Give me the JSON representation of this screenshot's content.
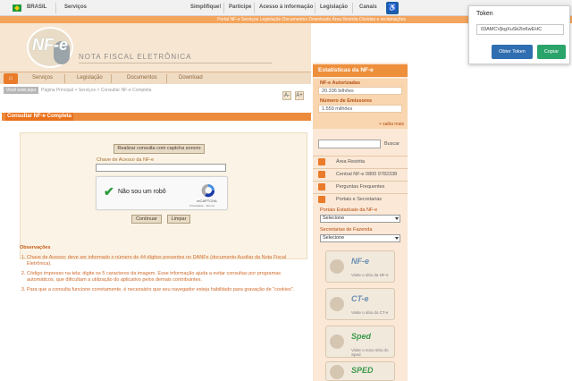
{
  "gov_bar": {
    "country": "BRASIL",
    "services": "Serviços",
    "links": [
      "Simplifique!",
      "Participe",
      "Acesso à informação",
      "Legislação",
      "Canais"
    ],
    "access_icon": "accessibility-icon"
  },
  "top_links": "Portal NF-e  Serviços  Legislação  Documentos  Downloads  Área Restrita  Dúvidas e reclamações",
  "header": {
    "logo_text": "NF-e",
    "brand": "NOTA FISCAL ELETRÔNICA"
  },
  "nav": {
    "items": [
      "Serviços",
      "Legislação",
      "Documentos",
      "Download"
    ],
    "home_icon": "home-icon"
  },
  "breadcrumb": {
    "you_are_here": "Você está aqui",
    "trail": "Página Principal > Serviços > Consultar NF-e Completa"
  },
  "page_title": "Consultar NF-e Completa",
  "form": {
    "captcha_sound_button": "Realizar consulta com captcha sonoro",
    "access_key_label": "Chave de Acesso da NF-e",
    "access_key_value": "",
    "recaptcha_text": "Não sou um robô",
    "recaptcha_brand": "reCAPTCHA",
    "recaptcha_links": "Privacidade - Termos",
    "continue_button": "Continuar",
    "clear_button": "Limpar"
  },
  "observations": {
    "title": "Observações",
    "items": [
      "Chave de Acesso: deve ser informado o número de 44 dígitos presentes no DANFe (documento Auxiliar da Nota Fiscal Eletrônica).",
      "Código impresso na tela: digite os 5 caracteres da imagem. Esse informação ajuda a evitar consultas por programas automáticos, que dificultam a utilização do aplicativo pelos demais contribuintes.",
      "Para que a consulta funcione corretamente, é necessário que seu navegador esteja habilitado para gravação de \"cookies\"."
    ]
  },
  "sidebar": {
    "stats_title": "Estatísticas da NF-e",
    "authorized_label": "NF-e Autorizadas",
    "authorized_value": "20.336 bilhões",
    "issuers_label": "Número de Emissores",
    "issuers_value": "1.559 milhões",
    "more_link": "+ saiba mais",
    "search_button": "Buscar",
    "links": [
      "Área Restrita",
      "Central NF-e 0800 9782338",
      "Perguntas Frequentes",
      "Portais e Secretarias"
    ],
    "state_portals_label": "Portais Estaduais da NF-e",
    "state_portals_value": "Selecione",
    "finance_label": "Secretarias de Fazenda",
    "finance_value": "Selecione",
    "promos": [
      {
        "main": "NF-e",
        "sub": "Visite o sítio da NF-e"
      },
      {
        "main": "CT-e",
        "sub": "Visite o sítio do CT-e"
      },
      {
        "main": "Sped",
        "sub": "Visite o novo sítio do Sped"
      },
      {
        "main": "SPED",
        "sub": ""
      }
    ]
  },
  "token_popup": {
    "title": "Token",
    "token_value": "03AMCVjkgXuSk2lo6wEHC",
    "get_button": "Obter Token",
    "copy_button": "Copiar"
  },
  "toolbar": {
    "font_decrease": "A-",
    "font_increase": "A+"
  }
}
